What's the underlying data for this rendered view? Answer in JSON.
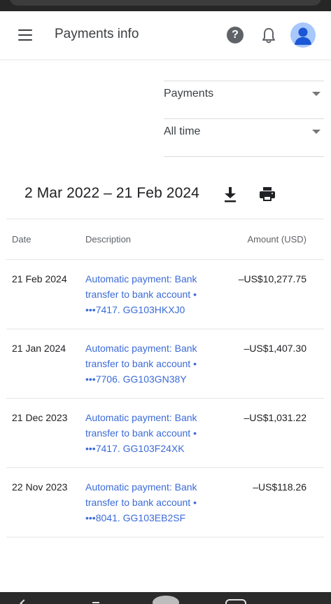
{
  "header": {
    "title": "Payments info"
  },
  "filters": {
    "type": "Payments",
    "period": "All time"
  },
  "range": {
    "label": "2 Mar 2022 – 21 Feb 2024"
  },
  "table": {
    "columns": {
      "date": "Date",
      "description": "Description",
      "amount": "Amount (USD)"
    },
    "rows": [
      {
        "date": "21 Feb 2024",
        "description": "Automatic payment: Bank transfer to bank account • •••7417. GG103HKXJ0",
        "amount": "–US$10,277.75"
      },
      {
        "date": "21 Jan 2024",
        "description": "Automatic payment: Bank transfer to bank account • •••7706. GG103GN38Y",
        "amount": "–US$1,407.30"
      },
      {
        "date": "21 Dec 2023",
        "description": "Automatic payment: Bank transfer to bank account • •••7417. GG103F24XK",
        "amount": "–US$1,031.22"
      },
      {
        "date": "22 Nov 2023",
        "description": "Automatic payment: Bank transfer to bank account • •••8041. GG103EB2SF",
        "amount": "–US$118.26"
      }
    ]
  },
  "icons": {
    "menu": "menu-icon",
    "help": "help-icon",
    "notifications": "bell-icon",
    "account": "avatar-icon",
    "download": "download-icon",
    "print": "print-icon",
    "dropdown": "chevron-down-icon"
  },
  "colors": {
    "link": "#3c6bd8",
    "avatar": "#a8c7fa",
    "avatar_figure": "#1a56d6"
  }
}
